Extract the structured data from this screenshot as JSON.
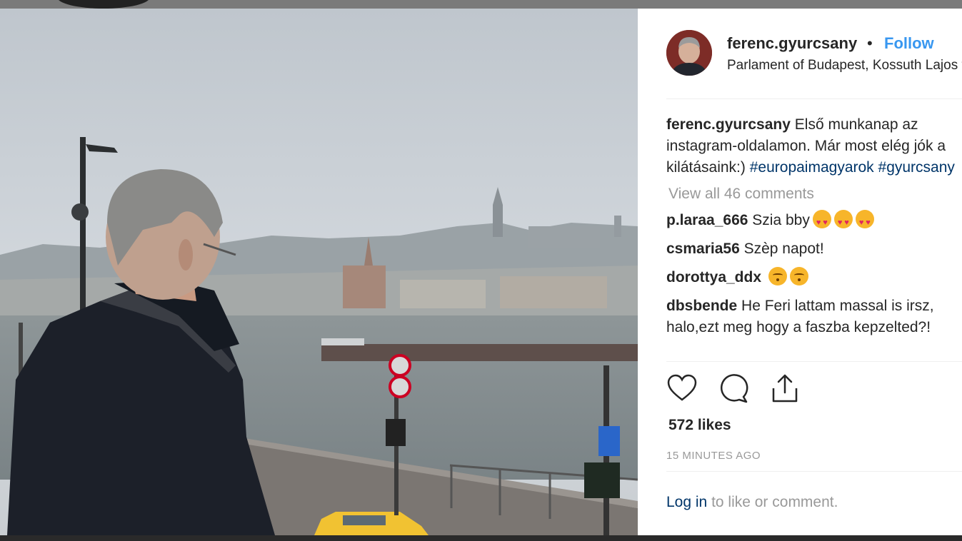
{
  "post": {
    "username": "ferenc.gyurcsany",
    "separator": "•",
    "follow_label": "Follow",
    "location": "Parlament of Budapest, Kossuth Lajos tér",
    "caption": {
      "username": "ferenc.gyurcsany",
      "text_line1": "Első munkanap az",
      "text_line2": "instagram-oldalamon. Már most elég jók a",
      "text_line3": "kilátásaink:)",
      "hashtag1": "#europaimagyarok",
      "hashtag2": "#gyurcsany"
    },
    "view_all_comments": "View all 46 comments",
    "comments": [
      {
        "username": "p.laraa_666",
        "text": "Szia bby",
        "emojis": [
          "heart-eyes-emoji",
          "heart-eyes-emoji",
          "heart-eyes-emoji"
        ]
      },
      {
        "username": "csmaria56",
        "text": "Szèp napot!"
      },
      {
        "username": "dorottya_ddx",
        "text": "",
        "emojis": [
          "kissing-emoji",
          "kissing-emoji"
        ]
      },
      {
        "username": "dbsbende",
        "text": "He Feri lattam massal is irsz,",
        "text2": "halo,ezt meg hogy a faszba kepzelted?!"
      }
    ],
    "actions": {
      "like_icon": "heart-icon",
      "comment_icon": "comment-bubble-icon",
      "share_icon": "share-icon"
    },
    "likes": "572 likes",
    "timestamp": "15 MINUTES AGO",
    "login_link": "Log in",
    "login_rest": "to like or comment."
  },
  "colors": {
    "link_blue": "#3897f0",
    "hashtag_blue": "#003569",
    "muted_gray": "#999999",
    "text": "#262626"
  }
}
